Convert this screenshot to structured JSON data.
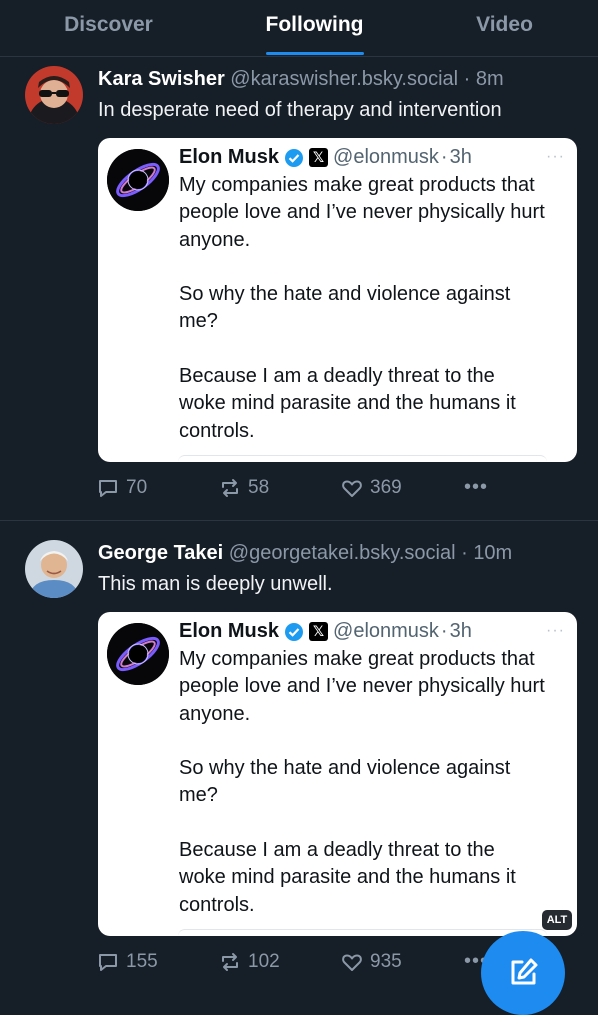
{
  "tabs": [
    {
      "label": "Discover",
      "active": false
    },
    {
      "label": "Following",
      "active": true
    },
    {
      "label": "Video",
      "active": false
    }
  ],
  "posts": [
    {
      "author": "Kara Swisher",
      "handle": "@karaswisher.bsky.social",
      "time": "8m",
      "text": "In desperate need of therapy and intervention",
      "embed": {
        "name": "Elon Musk",
        "handle": "@elonmusk",
        "time": "3h",
        "body": "My companies make great products that\npeople love and I’ve never physically hurt\nanyone.\n\nSo why the hate and violence against\nme?\n\nBecause I am a deadly threat to the\nwoke mind parasite and the humans it\ncontrols."
      },
      "stats": {
        "replies": "70",
        "reposts": "58",
        "likes": "369"
      }
    },
    {
      "author": "George Takei",
      "handle": "@georgetakei.bsky.social",
      "time": "10m",
      "text": "This man is deeply unwell.",
      "embed": {
        "name": "Elon Musk",
        "handle": "@elonmusk",
        "time": "3h",
        "body": "My companies make great products that\npeople love and I’ve never physically hurt\nanyone.\n\nSo why the hate and violence against\nme?\n\nBecause I am a deadly threat to the\nwoke mind parasite and the humans it\ncontrols."
      },
      "stats": {
        "replies": "155",
        "reposts": "102",
        "likes": "935"
      },
      "alt_badge": "ALT"
    }
  ],
  "icons": {
    "verified": "verified-check-icon",
    "platform": "x-logo-icon",
    "reply": "speech-bubble-icon",
    "repost": "repost-arrows-icon",
    "like": "heart-icon",
    "more": "ellipsis-icon",
    "compose": "compose-pencil-icon"
  },
  "colors": {
    "background": "#161e27",
    "accent": "#1d8bf0",
    "muted": "#8b98a8"
  }
}
